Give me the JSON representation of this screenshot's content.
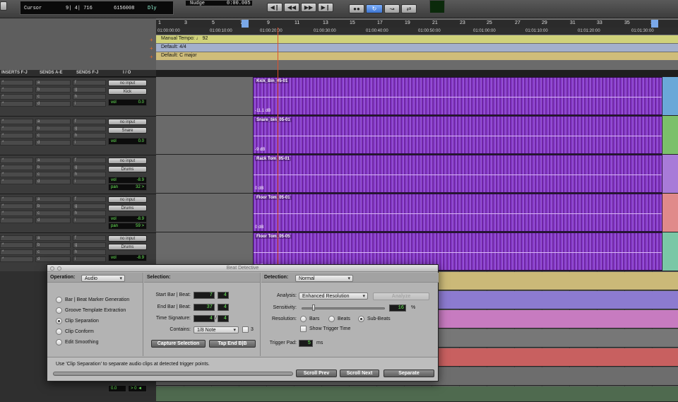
{
  "transport": {
    "counter_mode": "Cursor",
    "cursor_position": "9| 4| 716",
    "sample_readout": "6156008",
    "dly_label": "Dly",
    "nudge_label": "Nudge",
    "nudge_value": "0:00.005"
  },
  "ruler": {
    "bars": [
      "1",
      "3",
      "5",
      "7",
      "9",
      "11",
      "13",
      "15",
      "17",
      "19",
      "21",
      "23",
      "25",
      "27",
      "29",
      "31",
      "33",
      "35",
      "37"
    ],
    "minsecs": [
      "01:00:00:00",
      "01:00:10:00",
      "01:00:20:00",
      "01:00:30:00",
      "01:00:40:00",
      "01:00:50:00",
      "01:01:00:00",
      "01:01:10:00",
      "01:01:20:00",
      "01:01:30:00"
    ],
    "tempo": "Manual Tempo: ♩ 92",
    "meter": "Default: 4/4",
    "key": "Default: C major"
  },
  "mix_columns": {
    "inserts": "INSERTS F-J",
    "sends_ae": "SENDS A-E",
    "sends_fj": "SENDS F-J",
    "io": "I / O"
  },
  "tracks": [
    {
      "input": "no input",
      "output": "Kick",
      "vol_label": "vol",
      "vol": "0.0",
      "pan_label": "",
      "pan": "",
      "clip_name": "Kick_Bin_05-01",
      "clip_gain": "-11.1 dB"
    },
    {
      "input": "no input",
      "output": "Snare",
      "vol_label": "vol",
      "vol": "0.0",
      "pan_label": "",
      "pan": "",
      "clip_name": "Snare_bin_05-01",
      "clip_gain": "-9 dB"
    },
    {
      "input": "no input",
      "output": "Drums",
      "vol_label": "vol",
      "vol": "-8.9",
      "pan_label": "pan",
      "pan": "32 >",
      "clip_name": "Rack Tom_05-01",
      "clip_gain": "0 dB"
    },
    {
      "input": "no input",
      "output": "Drums",
      "vol_label": "vol",
      "vol": "-8.9",
      "pan_label": "pan",
      "pan": "59 >",
      "clip_name": "Floor Tom_05-01",
      "clip_gain": "0 dB"
    },
    {
      "input": "no input",
      "output": "Drums",
      "vol_label": "vol",
      "vol": "-8.9",
      "pan_label": "",
      "pan": "",
      "clip_name": "Floor Tom_05-05",
      "clip_gain": "0 dB"
    }
  ],
  "beat_detective": {
    "title": "Beat Detective",
    "operation_label": "Operation:",
    "operation_value": "Audio",
    "operations": [
      "Bar | Beat Marker Generation",
      "Groove Template Extraction",
      "Clip Separation",
      "Clip Conform",
      "Edit Smoothing"
    ],
    "selected_operation": "Clip Separation",
    "selection_label": "Selection:",
    "start_label": "Start Bar | Beat:",
    "start_bar": "7",
    "start_beat": "4",
    "end_label": "End Bar | Beat:",
    "end_bar": "37",
    "end_beat": "4",
    "timesig_label": "Time Signature:",
    "timesig_num": "4",
    "timesig_den": "4",
    "contains_label": "Contains:",
    "contains_value": "1/8 Note",
    "contains_extra": "3",
    "capture_button": "Capture Selection",
    "tap_end_button": "Tap End B|B",
    "detection_label": "Detection:",
    "detection_value": "Normal",
    "analysis_label": "Analysis:",
    "analysis_value": "Enhanced Resolution",
    "analyze_button": "Analyze",
    "sensitivity_label": "Sensitivity:",
    "sensitivity_value": "16",
    "sensitivity_unit": "%",
    "resolution_label": "Resolution:",
    "resolutions": [
      "Bars",
      "Beats",
      "Sub-Beats"
    ],
    "selected_resolution": "Sub-Beats",
    "show_trigger_label": "Show Trigger Time",
    "trigger_pad_label": "Trigger Pad:",
    "trigger_pad_value": "5",
    "trigger_pad_unit": "ms",
    "help_text": "Use 'Clip Separation' to separate audio clips at detected trigger points.",
    "scroll_prev": "Scroll Prev",
    "scroll_next": "Scroll Next",
    "separate": "Separate"
  },
  "bottom_mix": {
    "vol": "0.0",
    "arrows": "> 0 ◄"
  },
  "colors": {
    "clip_purple": "#7d2fb5",
    "tempo_ruler": "#c9c96a",
    "meter_ruler": "#9aa8c4",
    "key_ruler": "#c9b672",
    "lcd_green": "#6cf25a"
  }
}
